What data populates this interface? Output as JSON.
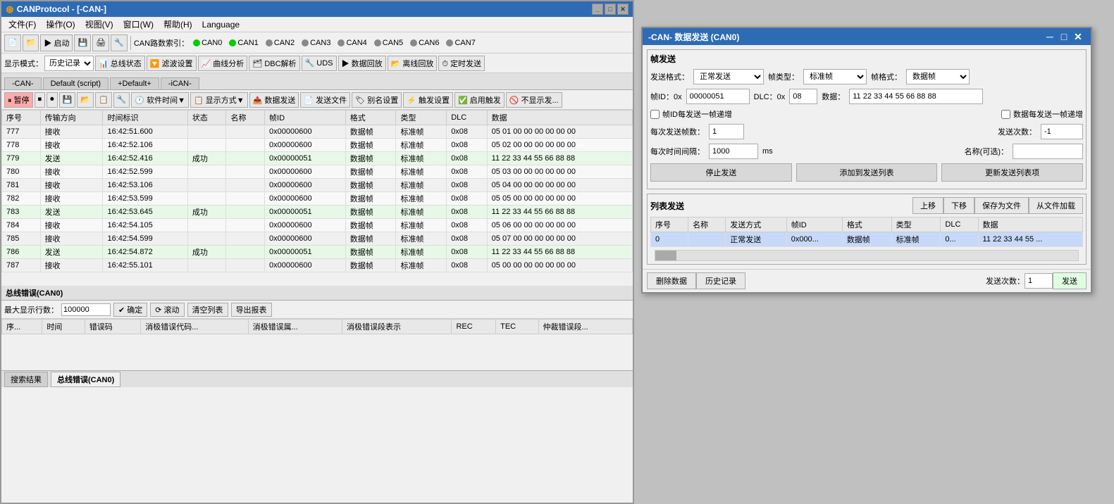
{
  "mainWindow": {
    "title": "CANProtocol - [-CAN-]",
    "titleIcon": "⊛"
  },
  "menuBar": {
    "items": [
      {
        "id": "file",
        "label": "文件(F)"
      },
      {
        "id": "op",
        "label": "操作(O)"
      },
      {
        "id": "view",
        "label": "视图(V)"
      },
      {
        "id": "window",
        "label": "窗口(W)"
      },
      {
        "id": "help",
        "label": "帮助(H)"
      },
      {
        "id": "lang",
        "label": "Language"
      }
    ]
  },
  "toolbar1": {
    "canLabel": "CAN路数索引：",
    "canTabs": [
      {
        "label": "CAN0",
        "active": true,
        "color": "green"
      },
      {
        "label": "CAN1",
        "active": false,
        "color": "green"
      },
      {
        "label": "CAN2",
        "active": false,
        "color": "gray"
      },
      {
        "label": "CAN3",
        "active": false,
        "color": "gray"
      },
      {
        "label": "CAN4",
        "active": false,
        "color": "gray"
      },
      {
        "label": "CAN5",
        "active": false,
        "color": "gray"
      },
      {
        "label": "CAN6",
        "active": false,
        "color": "gray"
      },
      {
        "label": "CAN7",
        "active": false,
        "color": "gray"
      }
    ]
  },
  "toolbar2": {
    "displayLabel": "显示模式：",
    "displayValue": "历史记录",
    "buttons": [
      {
        "id": "bus-status",
        "label": "总线状态",
        "icon": "📊"
      },
      {
        "id": "filter",
        "label": "滤波设置",
        "icon": "🔽"
      },
      {
        "id": "curve",
        "label": "曲线分析",
        "icon": "📈"
      },
      {
        "id": "dbc",
        "label": "DBC解析",
        "icon": "🗂"
      },
      {
        "id": "uds",
        "label": "UDS",
        "icon": "🔧"
      },
      {
        "id": "replay",
        "label": "数据回放",
        "icon": "▶"
      },
      {
        "id": "offline-replay",
        "label": "离线回放",
        "icon": "📂"
      },
      {
        "id": "timed-send",
        "label": "定时发送",
        "icon": "⏱"
      }
    ]
  },
  "tabStrip": {
    "tabs": [
      {
        "label": "-CAN-",
        "active": false
      },
      {
        "label": "Default (script)",
        "active": false
      },
      {
        "label": "+Default+",
        "active": false
      },
      {
        "label": "-iCAN-",
        "active": false
      }
    ]
  },
  "toolbar3": {
    "buttons": [
      {
        "id": "pause",
        "label": "暂停",
        "icon": "⏸",
        "style": "red"
      },
      {
        "id": "save",
        "label": "",
        "icon": "💾"
      },
      {
        "id": "open",
        "label": "",
        "icon": "📁"
      },
      {
        "id": "soft-time",
        "label": "软件时间▼",
        "icon": "🕐"
      },
      {
        "id": "display-mode",
        "label": "显示方式▼",
        "icon": "📋"
      },
      {
        "id": "data-send",
        "label": "数据发送",
        "icon": "📤"
      },
      {
        "id": "send-file",
        "label": "发送文件",
        "icon": "📄"
      },
      {
        "id": "alias",
        "label": "别名设置",
        "icon": "🏷"
      },
      {
        "id": "trigger",
        "label": "触发设置",
        "icon": "⚡"
      },
      {
        "id": "enable-trigger",
        "label": "启用触发",
        "icon": "✅"
      },
      {
        "id": "no-display",
        "label": "不显示发...",
        "icon": "🚫"
      }
    ]
  },
  "tableHeaders": [
    "序号",
    "传输方向",
    "时间标识",
    "状态",
    "名称",
    "帧ID",
    "格式",
    "类型",
    "DLC",
    "数据"
  ],
  "tableRows": [
    {
      "id": "777",
      "dir": "接收",
      "time": "16:42:51.600",
      "status": "",
      "name": "",
      "frameId": "0x00000600",
      "format": "数据帧",
      "type": "标准帧",
      "dlc": "0x08",
      "data": "05 01 00 00 00 00 00 00"
    },
    {
      "id": "778",
      "dir": "接收",
      "time": "16:42:52.106",
      "status": "",
      "name": "",
      "frameId": "0x00000600",
      "format": "数据帧",
      "type": "标准帧",
      "dlc": "0x08",
      "data": "05 02 00 00 00 00 00 00"
    },
    {
      "id": "779",
      "dir": "发送",
      "time": "16:42:52.416",
      "status": "成功",
      "name": "",
      "frameId": "0x00000051",
      "format": "数据帧",
      "type": "标准帧",
      "dlc": "0x08",
      "data": "11 22 33 44 55 66 88 88"
    },
    {
      "id": "780",
      "dir": "接收",
      "time": "16:42:52.599",
      "status": "",
      "name": "",
      "frameId": "0x00000600",
      "format": "数据帧",
      "type": "标准帧",
      "dlc": "0x08",
      "data": "05 03 00 00 00 00 00 00"
    },
    {
      "id": "781",
      "dir": "接收",
      "time": "16:42:53.106",
      "status": "",
      "name": "",
      "frameId": "0x00000600",
      "format": "数据帧",
      "type": "标准帧",
      "dlc": "0x08",
      "data": "05 04 00 00 00 00 00 00"
    },
    {
      "id": "782",
      "dir": "接收",
      "time": "16:42:53.599",
      "status": "",
      "name": "",
      "frameId": "0x00000600",
      "format": "数据帧",
      "type": "标准帧",
      "dlc": "0x08",
      "data": "05 05 00 00 00 00 00 00"
    },
    {
      "id": "783",
      "dir": "发送",
      "time": "16:42:53.645",
      "status": "成功",
      "name": "",
      "frameId": "0x00000051",
      "format": "数据帧",
      "type": "标准帧",
      "dlc": "0x08",
      "data": "11 22 33 44 55 66 88 88"
    },
    {
      "id": "784",
      "dir": "接收",
      "time": "16:42:54.105",
      "status": "",
      "name": "",
      "frameId": "0x00000600",
      "format": "数据帧",
      "type": "标准帧",
      "dlc": "0x08",
      "data": "05 06 00 00 00 00 00 00"
    },
    {
      "id": "785",
      "dir": "接收",
      "time": "16:42:54.599",
      "status": "",
      "name": "",
      "frameId": "0x00000600",
      "format": "数据帧",
      "type": "标准帧",
      "dlc": "0x08",
      "data": "05 07 00 00 00 00 00 00"
    },
    {
      "id": "786",
      "dir": "发送",
      "time": "16:42:54.872",
      "status": "成功",
      "name": "",
      "frameId": "0x00000051",
      "format": "数据帧",
      "type": "标准帧",
      "dlc": "0x08",
      "data": "11 22 33 44 55 66 88 88"
    },
    {
      "id": "787",
      "dir": "接收",
      "time": "16:42:55.101",
      "status": "",
      "name": "",
      "frameId": "0x00000600",
      "format": "数据帧",
      "type": "标准帧",
      "dlc": "0x08",
      "data": "05 00 00 00 00 00 00 00"
    }
  ],
  "errorPanel": {
    "title": "总线错误(CAN0)",
    "maxRowsLabel": "最大显示行数：",
    "maxRowsValue": "100000",
    "confirmLabel": "✔ 确定",
    "scrollLabel": "⟳ 滚动",
    "clearLabel": "清空列表",
    "exportLabel": "导出报表",
    "headers": [
      "序...",
      "时间",
      "错误码",
      "消极错误代码...",
      "消极错误属...",
      "消极错误段表示",
      "REC",
      "TEC",
      "仲裁错误段..."
    ]
  },
  "statusBar": {
    "tabs": [
      {
        "label": "搜索结果",
        "active": false
      },
      {
        "label": "总线错误(CAN0)",
        "active": true
      }
    ]
  },
  "canDialog": {
    "title": "-CAN- 数据发送 (CAN0)",
    "frameSection": {
      "title": "帧发送",
      "sendFormatLabel": "发送格式：",
      "sendFormatValue": "正常发送",
      "frameTypeLabel": "帧类型：",
      "frameTypeValue": "标准帧",
      "frameFormatLabel": "帧格式：",
      "frameFormatValue": "数据帧",
      "frameIdLabel": "帧ID：0x",
      "frameIdValue": "00000051",
      "dlcLabel": "DLC：0x",
      "dlcValue": "08",
      "dataLabel": "数据：",
      "dataValue": "11 22 33 44 55 66 88 88",
      "checkIncrIdLabel": "帧ID每发送一帧递增",
      "checkIncrDataLabel": "数据每发送一帧递增",
      "sendCountPerLabel": "每次发送帧数：",
      "sendCountPerValue": "1",
      "totalSendLabel": "发送次数：",
      "totalSendValue": "-1",
      "intervalLabel": "每次时间间隔：",
      "intervalValue": "1000",
      "intervalUnit": "ms",
      "nameLabel": "名称(可选)：",
      "nameValue": "",
      "stopSendBtn": "停止发送",
      "addToListBtn": "添加到发送列表",
      "updateListBtn": "更新发送列表项"
    },
    "listSection": {
      "title": "列表发送",
      "upBtn": "上移",
      "downBtn": "下移",
      "saveFileBtn": "保存为文件",
      "loadFileBtn": "从文件加载",
      "headers": [
        "序号",
        "名称",
        "发送方式",
        "帧ID",
        "格式",
        "类型",
        "DLC",
        "数据"
      ],
      "rows": [
        {
          "id": "0",
          "name": "",
          "sendMode": "正常发送",
          "frameId": "0x000...",
          "format": "数据帧",
          "type": "标准帧",
          "dlc": "0...",
          "data": "11 22 33 44 55 ..."
        }
      ],
      "deleteBtn": "删除数据",
      "historyBtn": "历史记录",
      "sendBtn": "发送",
      "sendCountLabel": "发送次数：",
      "sendCountValue": "1"
    }
  },
  "colors": {
    "titleBarBg": "#2d6bb5",
    "accent": "#0066cc",
    "greenDot": "#00cc00",
    "grayDot": "#888888",
    "tableBorder": "#cccccc",
    "selectedRow": "#c8d8f8"
  }
}
